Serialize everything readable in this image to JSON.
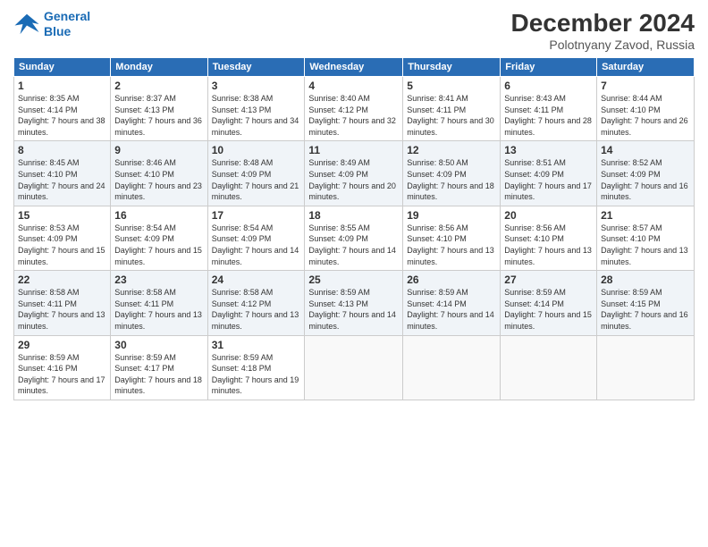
{
  "logo": {
    "line1": "General",
    "line2": "Blue"
  },
  "title": "December 2024",
  "location": "Polotnyany Zavod, Russia",
  "days_of_week": [
    "Sunday",
    "Monday",
    "Tuesday",
    "Wednesday",
    "Thursday",
    "Friday",
    "Saturday"
  ],
  "weeks": [
    [
      {
        "day": "1",
        "sunrise": "Sunrise: 8:35 AM",
        "sunset": "Sunset: 4:14 PM",
        "daylight": "Daylight: 7 hours and 38 minutes."
      },
      {
        "day": "2",
        "sunrise": "Sunrise: 8:37 AM",
        "sunset": "Sunset: 4:13 PM",
        "daylight": "Daylight: 7 hours and 36 minutes."
      },
      {
        "day": "3",
        "sunrise": "Sunrise: 8:38 AM",
        "sunset": "Sunset: 4:13 PM",
        "daylight": "Daylight: 7 hours and 34 minutes."
      },
      {
        "day": "4",
        "sunrise": "Sunrise: 8:40 AM",
        "sunset": "Sunset: 4:12 PM",
        "daylight": "Daylight: 7 hours and 32 minutes."
      },
      {
        "day": "5",
        "sunrise": "Sunrise: 8:41 AM",
        "sunset": "Sunset: 4:11 PM",
        "daylight": "Daylight: 7 hours and 30 minutes."
      },
      {
        "day": "6",
        "sunrise": "Sunrise: 8:43 AM",
        "sunset": "Sunset: 4:11 PM",
        "daylight": "Daylight: 7 hours and 28 minutes."
      },
      {
        "day": "7",
        "sunrise": "Sunrise: 8:44 AM",
        "sunset": "Sunset: 4:10 PM",
        "daylight": "Daylight: 7 hours and 26 minutes."
      }
    ],
    [
      {
        "day": "8",
        "sunrise": "Sunrise: 8:45 AM",
        "sunset": "Sunset: 4:10 PM",
        "daylight": "Daylight: 7 hours and 24 minutes."
      },
      {
        "day": "9",
        "sunrise": "Sunrise: 8:46 AM",
        "sunset": "Sunset: 4:10 PM",
        "daylight": "Daylight: 7 hours and 23 minutes."
      },
      {
        "day": "10",
        "sunrise": "Sunrise: 8:48 AM",
        "sunset": "Sunset: 4:09 PM",
        "daylight": "Daylight: 7 hours and 21 minutes."
      },
      {
        "day": "11",
        "sunrise": "Sunrise: 8:49 AM",
        "sunset": "Sunset: 4:09 PM",
        "daylight": "Daylight: 7 hours and 20 minutes."
      },
      {
        "day": "12",
        "sunrise": "Sunrise: 8:50 AM",
        "sunset": "Sunset: 4:09 PM",
        "daylight": "Daylight: 7 hours and 18 minutes."
      },
      {
        "day": "13",
        "sunrise": "Sunrise: 8:51 AM",
        "sunset": "Sunset: 4:09 PM",
        "daylight": "Daylight: 7 hours and 17 minutes."
      },
      {
        "day": "14",
        "sunrise": "Sunrise: 8:52 AM",
        "sunset": "Sunset: 4:09 PM",
        "daylight": "Daylight: 7 hours and 16 minutes."
      }
    ],
    [
      {
        "day": "15",
        "sunrise": "Sunrise: 8:53 AM",
        "sunset": "Sunset: 4:09 PM",
        "daylight": "Daylight: 7 hours and 15 minutes."
      },
      {
        "day": "16",
        "sunrise": "Sunrise: 8:54 AM",
        "sunset": "Sunset: 4:09 PM",
        "daylight": "Daylight: 7 hours and 15 minutes."
      },
      {
        "day": "17",
        "sunrise": "Sunrise: 8:54 AM",
        "sunset": "Sunset: 4:09 PM",
        "daylight": "Daylight: 7 hours and 14 minutes."
      },
      {
        "day": "18",
        "sunrise": "Sunrise: 8:55 AM",
        "sunset": "Sunset: 4:09 PM",
        "daylight": "Daylight: 7 hours and 14 minutes."
      },
      {
        "day": "19",
        "sunrise": "Sunrise: 8:56 AM",
        "sunset": "Sunset: 4:10 PM",
        "daylight": "Daylight: 7 hours and 13 minutes."
      },
      {
        "day": "20",
        "sunrise": "Sunrise: 8:56 AM",
        "sunset": "Sunset: 4:10 PM",
        "daylight": "Daylight: 7 hours and 13 minutes."
      },
      {
        "day": "21",
        "sunrise": "Sunrise: 8:57 AM",
        "sunset": "Sunset: 4:10 PM",
        "daylight": "Daylight: 7 hours and 13 minutes."
      }
    ],
    [
      {
        "day": "22",
        "sunrise": "Sunrise: 8:58 AM",
        "sunset": "Sunset: 4:11 PM",
        "daylight": "Daylight: 7 hours and 13 minutes."
      },
      {
        "day": "23",
        "sunrise": "Sunrise: 8:58 AM",
        "sunset": "Sunset: 4:11 PM",
        "daylight": "Daylight: 7 hours and 13 minutes."
      },
      {
        "day": "24",
        "sunrise": "Sunrise: 8:58 AM",
        "sunset": "Sunset: 4:12 PM",
        "daylight": "Daylight: 7 hours and 13 minutes."
      },
      {
        "day": "25",
        "sunrise": "Sunrise: 8:59 AM",
        "sunset": "Sunset: 4:13 PM",
        "daylight": "Daylight: 7 hours and 14 minutes."
      },
      {
        "day": "26",
        "sunrise": "Sunrise: 8:59 AM",
        "sunset": "Sunset: 4:14 PM",
        "daylight": "Daylight: 7 hours and 14 minutes."
      },
      {
        "day": "27",
        "sunrise": "Sunrise: 8:59 AM",
        "sunset": "Sunset: 4:14 PM",
        "daylight": "Daylight: 7 hours and 15 minutes."
      },
      {
        "day": "28",
        "sunrise": "Sunrise: 8:59 AM",
        "sunset": "Sunset: 4:15 PM",
        "daylight": "Daylight: 7 hours and 16 minutes."
      }
    ],
    [
      {
        "day": "29",
        "sunrise": "Sunrise: 8:59 AM",
        "sunset": "Sunset: 4:16 PM",
        "daylight": "Daylight: 7 hours and 17 minutes."
      },
      {
        "day": "30",
        "sunrise": "Sunrise: 8:59 AM",
        "sunset": "Sunset: 4:17 PM",
        "daylight": "Daylight: 7 hours and 18 minutes."
      },
      {
        "day": "31",
        "sunrise": "Sunrise: 8:59 AM",
        "sunset": "Sunset: 4:18 PM",
        "daylight": "Daylight: 7 hours and 19 minutes."
      },
      null,
      null,
      null,
      null
    ]
  ]
}
